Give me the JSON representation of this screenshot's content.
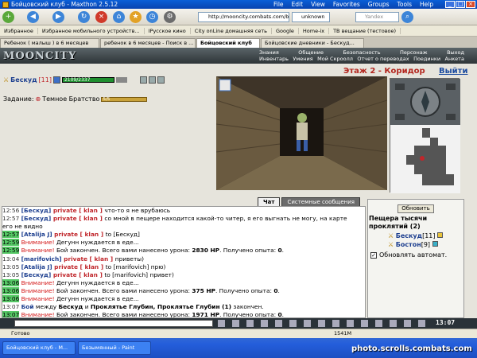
{
  "window": {
    "title": "Бойцовский клуб - Maxthon 2.5.12",
    "menu": [
      "File",
      "Edit",
      "View",
      "Favorites",
      "Groups",
      "Tools",
      "Help"
    ]
  },
  "toolbar": {
    "address": "http://mooncity.combats.com/buttor",
    "proxy": "unknown",
    "search_placeholder": "Yandex"
  },
  "favorites": [
    "Избранное",
    "Избранное мобильного устройств...",
    "IРусское кино",
    "City onLine домашняя сеть",
    "Google",
    "Home-ix",
    "ТВ вещание (тестовое)"
  ],
  "tabs": [
    {
      "label": "Ребенок ( малыш ) в 6 месяцев",
      "active": false
    },
    {
      "label": "ребенок в 6 месяцев - Поиск в ...",
      "active": false
    },
    {
      "label": "Бойцовский клуб",
      "active": true
    },
    {
      "label": "Бойцовские дневники - Бескуд...",
      "active": false
    }
  ],
  "game": {
    "logo": "MOONCITY",
    "nav_top": [
      "Знания",
      "Общение",
      "Безопасность",
      "Персонаж",
      "Выход"
    ],
    "nav_bottom": [
      "Инвентарь",
      "Умения",
      "Мой Скроолл",
      "Отчет о переводах",
      "Поединки",
      "Анкета"
    ],
    "player": {
      "name": "Бескуд",
      "level": "[11]",
      "hp": "2109/2337"
    },
    "task_label": "Задание:",
    "task_name": "Темное Братство",
    "task_progress": "5/5",
    "task_fill": 1,
    "location": "Этаж 2 - Коридор",
    "exit_label": "Выйти",
    "chat_tabs": [
      "Чат",
      "Системные сообщения"
    ],
    "refresh_label": "Обновить",
    "side_title": "Пещера тысячи проклятий (2)",
    "online": [
      {
        "name": "Бескуд",
        "level": "[11]"
      },
      {
        "name": "Бостон",
        "level": "[9]"
      }
    ],
    "auto_refresh_label": "Обновлять автомат.",
    "clock": "13:07"
  },
  "chat": [
    {
      "time": "12:56",
      "hl": false,
      "parts": [
        [
          "nick",
          "[Бескуд]"
        ],
        [
          "priv",
          " private [ klan ] "
        ],
        [
          "plain",
          "что-то я не врубаюсь"
        ]
      ]
    },
    {
      "time": "12:57",
      "hl": false,
      "parts": [
        [
          "nick",
          "[Бескуд]"
        ],
        [
          "priv",
          " private [ klan ] "
        ],
        [
          "plain",
          "со мной в пещере находится какой-то читер, я его выгнать не могу, на карте"
        ]
      ]
    },
    {
      "time": "",
      "hl": false,
      "parts": [
        [
          "plain",
          "его не видно"
        ]
      ]
    },
    {
      "time": "12:57",
      "hl": true,
      "parts": [
        [
          "nick",
          "[Atalija J]"
        ],
        [
          "priv",
          " private [ klan ] "
        ],
        [
          "plain",
          "to [Бескуд]"
        ]
      ]
    },
    {
      "time": "12:59",
      "hl": true,
      "parts": [
        [
          "warn",
          "Внимание!"
        ],
        [
          "plain",
          " Дегунн нуждается в еде..."
        ]
      ]
    },
    {
      "time": "12:59",
      "hl": true,
      "parts": [
        [
          "warn",
          "Внимание!"
        ],
        [
          "plain",
          " Бой закончен. Всего вами нанесено урона: "
        ],
        [
          "b",
          "2830 HP"
        ],
        [
          "plain",
          ". Получено опыта: "
        ],
        [
          "b",
          "0"
        ],
        [
          "plain",
          "."
        ]
      ]
    },
    {
      "time": "13:04",
      "hl": false,
      "parts": [
        [
          "nick",
          "[marifovich]"
        ],
        [
          "priv",
          " private [ klan ] "
        ],
        [
          "plain",
          "приветы)"
        ]
      ]
    },
    {
      "time": "13:05",
      "hl": false,
      "parts": [
        [
          "nick",
          "[Atalija J]"
        ],
        [
          "priv",
          " private [ klan ] "
        ],
        [
          "plain",
          "to [marifovich] прю)"
        ]
      ]
    },
    {
      "time": "13:05",
      "hl": false,
      "parts": [
        [
          "nick",
          "[Бескуд]"
        ],
        [
          "priv",
          " private [ klan ] "
        ],
        [
          "plain",
          "to [marifovich] привет)"
        ]
      ]
    },
    {
      "time": "13:06",
      "hl": true,
      "parts": [
        [
          "warn",
          "Внимание!"
        ],
        [
          "plain",
          " Дегунн нуждается в еде..."
        ]
      ]
    },
    {
      "time": "13:06",
      "hl": true,
      "parts": [
        [
          "warn",
          "Внимание!"
        ],
        [
          "plain",
          " Бой закончен. Всего вами нанесено урона: "
        ],
        [
          "b",
          "375 HP"
        ],
        [
          "plain",
          ". Получено опыта: "
        ],
        [
          "b",
          "0"
        ],
        [
          "plain",
          "."
        ]
      ]
    },
    {
      "time": "13:06",
      "hl": true,
      "parts": [
        [
          "warn",
          "Внимание!"
        ],
        [
          "plain",
          " Дегунн нуждается в еде..."
        ]
      ]
    },
    {
      "time": "13:07",
      "hl": false,
      "parts": [
        [
          "nick",
          "Бой"
        ],
        [
          "plain",
          " между "
        ],
        [
          "b",
          "Бескуд"
        ],
        [
          "plain",
          " и "
        ],
        [
          "b",
          "Проклятье Глубин, Проклятье Глубин (1)"
        ],
        [
          "plain",
          " закончен."
        ]
      ]
    },
    {
      "time": "13:07",
      "hl": true,
      "parts": [
        [
          "warn",
          "Внимание!"
        ],
        [
          "plain",
          " Бой закончен. Всего вами нанесено урона: "
        ],
        [
          "b",
          "1971 HP"
        ],
        [
          "plain",
          ". Получено опыта: "
        ],
        [
          "b",
          "0"
        ],
        [
          "plain",
          "."
        ]
      ]
    }
  ],
  "statusbar": {
    "text": "Готово",
    "memory": "1541M"
  },
  "taskbar": [
    "Бойцовский клуб - М...",
    "Безымянный - Paint"
  ],
  "watermark": "photo.scrolls.combats.com",
  "colors": {
    "accent": "#1d3f8f",
    "private": "#c0262b",
    "warning": "#d41a1a",
    "highlight": "#55c865"
  }
}
